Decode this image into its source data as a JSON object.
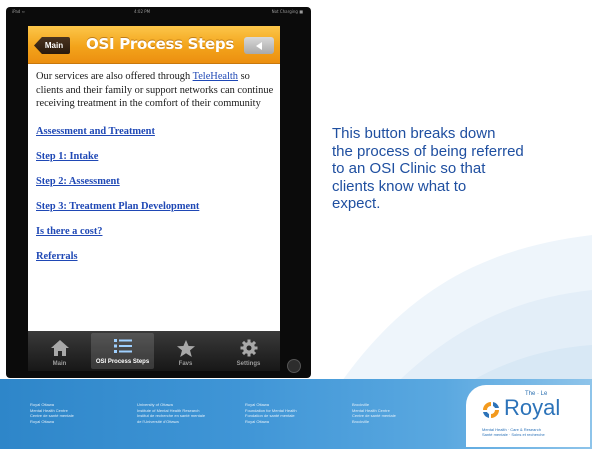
{
  "device": {
    "status_left": "iPad ≈",
    "status_center": "4:02 PM",
    "status_right": "Not Charging ■"
  },
  "navbar": {
    "back_label": "Main",
    "title": "OSI Process Steps"
  },
  "content": {
    "intro_before": "Our services are also offered through ",
    "intro_link": "TeleHealth",
    "intro_after": " so clients and their family or support networks can continue receiving treatment in the comfort of their community",
    "links": [
      "Assessment and Treatment",
      "Step 1: Intake",
      "Step 2: Assessment",
      "Step 3: Treatment Plan Development",
      "Is there a cost?",
      "Referrals"
    ]
  },
  "tabbar": {
    "tabs": [
      {
        "label": "Main",
        "icon": "house-icon",
        "active": false
      },
      {
        "label": "OSI Process Steps",
        "icon": "list-icon",
        "active": true
      },
      {
        "label": "Favs",
        "icon": "star-icon",
        "active": false
      },
      {
        "label": "Settings",
        "icon": "gear-icon",
        "active": false
      }
    ]
  },
  "callout": {
    "line1": "This button breaks down",
    "line2": "the process of being referred",
    "line3": "to an OSI Clinic so that",
    "line4": "clients know what to",
    "line5": "expect."
  },
  "footer": {
    "columns": [
      [
        "Royal Ottawa",
        "Mental Health Centre",
        "Centre de santé mentale",
        "Royal Ottawa"
      ],
      [
        "University of Ottawa",
        "Institute of Mental Health Research",
        "Institut de recherche en santé mentale",
        "de l'Université d'Ottawa"
      ],
      [
        "Royal Ottawa",
        "Foundation for Mental Health",
        "Fondation de santé mentale",
        "Royal Ottawa"
      ],
      [
        "Brockville",
        "Mental Health Centre",
        "Centre de santé mentale",
        "Brockville"
      ]
    ],
    "logo_prefix": "The · Le",
    "logo_word": "Royal",
    "logo_tag_line1": "Mental Health · Care & Research",
    "logo_tag_line2": "Santé mentale · Soins et recherche"
  },
  "colors": {
    "accent_orange": "#f3a41b",
    "link_blue": "#1f48b5",
    "callout_blue": "#1f4fa0",
    "footer_blue": "#2e86c9"
  }
}
